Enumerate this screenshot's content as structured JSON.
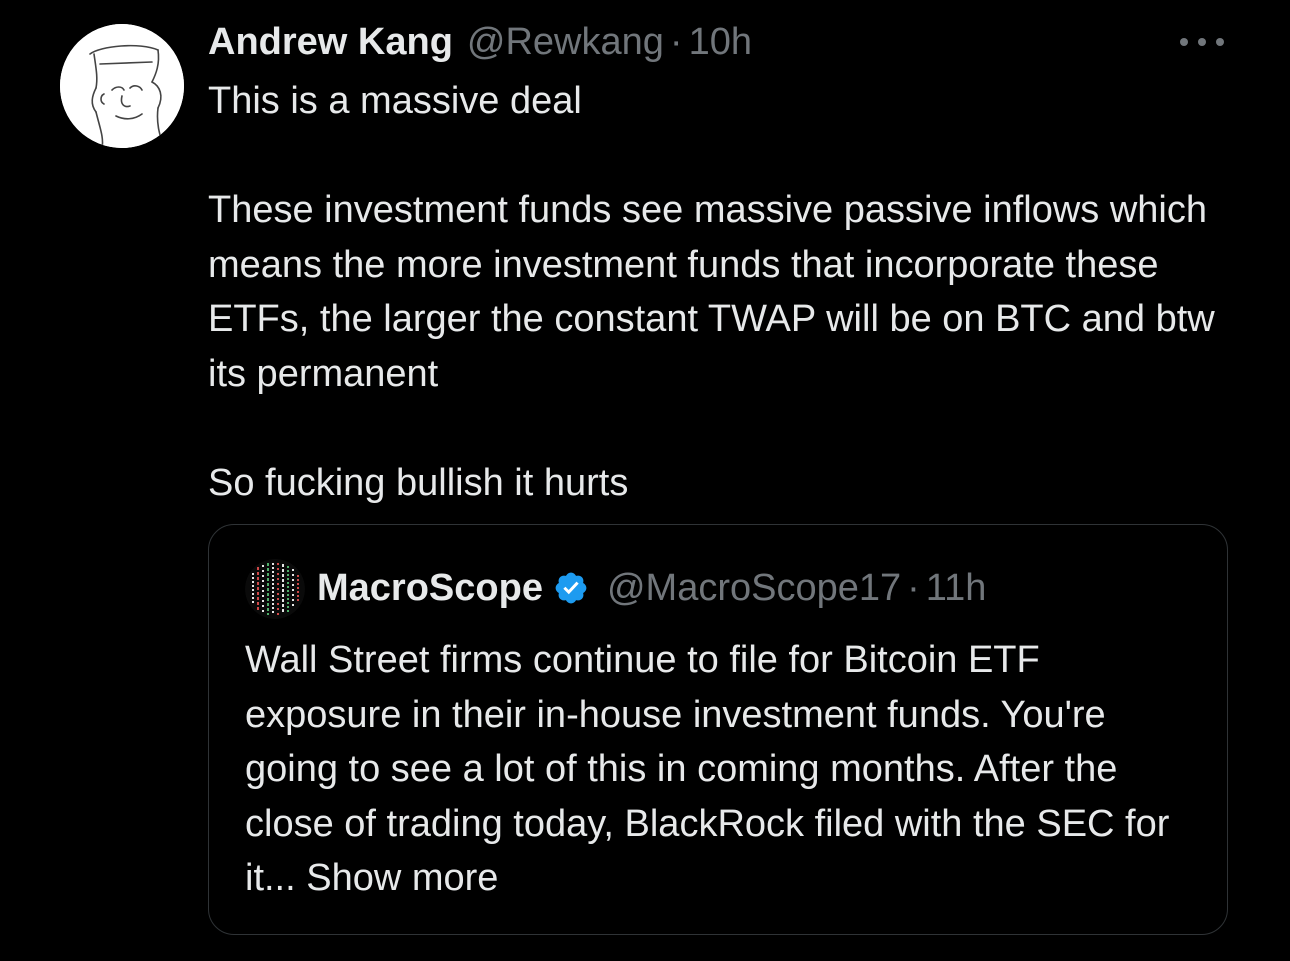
{
  "tweet": {
    "display_name": "Andrew Kang",
    "handle": "@Rewkang",
    "separator": "·",
    "time": "10h",
    "avatar_icon": "cartoon-character-avatar",
    "more_icon": "ellipsis-icon",
    "paragraphs": [
      "This is a massive deal",
      "These investment funds see massive passive inflows which means the more investment funds that incorporate these ETFs, the larger the constant TWAP will be on BTC and btw its permanent",
      "So fucking bullish it hurts"
    ]
  },
  "quote": {
    "display_name": "MacroScope",
    "handle": "@MacroScope17",
    "separator": "·",
    "time": "11h",
    "verified_icon": "verified-badge-icon",
    "avatar_icon": "market-ticker-avatar",
    "text": "Wall Street firms continue to file for Bitcoin ETF exposure in their in-house investment funds. You're going to see a lot of this in coming months. After the close of trading today, BlackRock filed with the SEC for it...",
    "show_more": "Show more"
  },
  "colors": {
    "background": "#000000",
    "text_primary": "#e7e9ea",
    "text_secondary": "#71767b",
    "border": "#2f3336",
    "verified_blue": "#1d9bf0"
  }
}
